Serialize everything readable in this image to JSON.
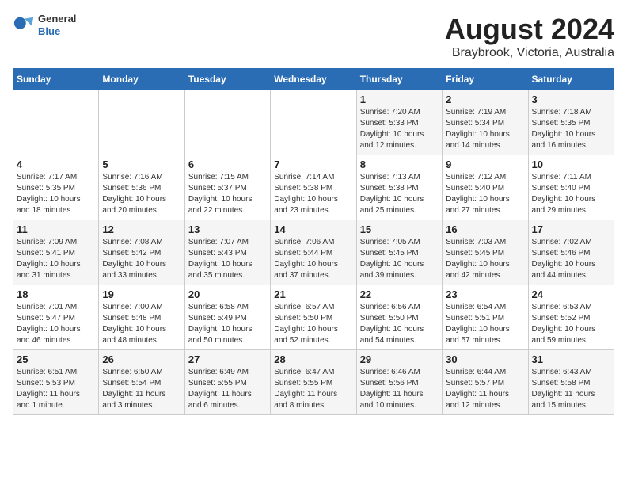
{
  "logo": {
    "general": "General",
    "blue": "Blue"
  },
  "title": "August 2024",
  "subtitle": "Braybrook, Victoria, Australia",
  "days_header": [
    "Sunday",
    "Monday",
    "Tuesday",
    "Wednesday",
    "Thursday",
    "Friday",
    "Saturday"
  ],
  "weeks": [
    [
      {
        "day": "",
        "info": ""
      },
      {
        "day": "",
        "info": ""
      },
      {
        "day": "",
        "info": ""
      },
      {
        "day": "",
        "info": ""
      },
      {
        "day": "1",
        "info": "Sunrise: 7:20 AM\nSunset: 5:33 PM\nDaylight: 10 hours\nand 12 minutes."
      },
      {
        "day": "2",
        "info": "Sunrise: 7:19 AM\nSunset: 5:34 PM\nDaylight: 10 hours\nand 14 minutes."
      },
      {
        "day": "3",
        "info": "Sunrise: 7:18 AM\nSunset: 5:35 PM\nDaylight: 10 hours\nand 16 minutes."
      }
    ],
    [
      {
        "day": "4",
        "info": "Sunrise: 7:17 AM\nSunset: 5:35 PM\nDaylight: 10 hours\nand 18 minutes."
      },
      {
        "day": "5",
        "info": "Sunrise: 7:16 AM\nSunset: 5:36 PM\nDaylight: 10 hours\nand 20 minutes."
      },
      {
        "day": "6",
        "info": "Sunrise: 7:15 AM\nSunset: 5:37 PM\nDaylight: 10 hours\nand 22 minutes."
      },
      {
        "day": "7",
        "info": "Sunrise: 7:14 AM\nSunset: 5:38 PM\nDaylight: 10 hours\nand 23 minutes."
      },
      {
        "day": "8",
        "info": "Sunrise: 7:13 AM\nSunset: 5:38 PM\nDaylight: 10 hours\nand 25 minutes."
      },
      {
        "day": "9",
        "info": "Sunrise: 7:12 AM\nSunset: 5:40 PM\nDaylight: 10 hours\nand 27 minutes."
      },
      {
        "day": "10",
        "info": "Sunrise: 7:11 AM\nSunset: 5:40 PM\nDaylight: 10 hours\nand 29 minutes."
      }
    ],
    [
      {
        "day": "11",
        "info": "Sunrise: 7:09 AM\nSunset: 5:41 PM\nDaylight: 10 hours\nand 31 minutes."
      },
      {
        "day": "12",
        "info": "Sunrise: 7:08 AM\nSunset: 5:42 PM\nDaylight: 10 hours\nand 33 minutes."
      },
      {
        "day": "13",
        "info": "Sunrise: 7:07 AM\nSunset: 5:43 PM\nDaylight: 10 hours\nand 35 minutes."
      },
      {
        "day": "14",
        "info": "Sunrise: 7:06 AM\nSunset: 5:44 PM\nDaylight: 10 hours\nand 37 minutes."
      },
      {
        "day": "15",
        "info": "Sunrise: 7:05 AM\nSunset: 5:45 PM\nDaylight: 10 hours\nand 39 minutes."
      },
      {
        "day": "16",
        "info": "Sunrise: 7:03 AM\nSunset: 5:45 PM\nDaylight: 10 hours\nand 42 minutes."
      },
      {
        "day": "17",
        "info": "Sunrise: 7:02 AM\nSunset: 5:46 PM\nDaylight: 10 hours\nand 44 minutes."
      }
    ],
    [
      {
        "day": "18",
        "info": "Sunrise: 7:01 AM\nSunset: 5:47 PM\nDaylight: 10 hours\nand 46 minutes."
      },
      {
        "day": "19",
        "info": "Sunrise: 7:00 AM\nSunset: 5:48 PM\nDaylight: 10 hours\nand 48 minutes."
      },
      {
        "day": "20",
        "info": "Sunrise: 6:58 AM\nSunset: 5:49 PM\nDaylight: 10 hours\nand 50 minutes."
      },
      {
        "day": "21",
        "info": "Sunrise: 6:57 AM\nSunset: 5:50 PM\nDaylight: 10 hours\nand 52 minutes."
      },
      {
        "day": "22",
        "info": "Sunrise: 6:56 AM\nSunset: 5:50 PM\nDaylight: 10 hours\nand 54 minutes."
      },
      {
        "day": "23",
        "info": "Sunrise: 6:54 AM\nSunset: 5:51 PM\nDaylight: 10 hours\nand 57 minutes."
      },
      {
        "day": "24",
        "info": "Sunrise: 6:53 AM\nSunset: 5:52 PM\nDaylight: 10 hours\nand 59 minutes."
      }
    ],
    [
      {
        "day": "25",
        "info": "Sunrise: 6:51 AM\nSunset: 5:53 PM\nDaylight: 11 hours\nand 1 minute."
      },
      {
        "day": "26",
        "info": "Sunrise: 6:50 AM\nSunset: 5:54 PM\nDaylight: 11 hours\nand 3 minutes."
      },
      {
        "day": "27",
        "info": "Sunrise: 6:49 AM\nSunset: 5:55 PM\nDaylight: 11 hours\nand 6 minutes."
      },
      {
        "day": "28",
        "info": "Sunrise: 6:47 AM\nSunset: 5:55 PM\nDaylight: 11 hours\nand 8 minutes."
      },
      {
        "day": "29",
        "info": "Sunrise: 6:46 AM\nSunset: 5:56 PM\nDaylight: 11 hours\nand 10 minutes."
      },
      {
        "day": "30",
        "info": "Sunrise: 6:44 AM\nSunset: 5:57 PM\nDaylight: 11 hours\nand 12 minutes."
      },
      {
        "day": "31",
        "info": "Sunrise: 6:43 AM\nSunset: 5:58 PM\nDaylight: 11 hours\nand 15 minutes."
      }
    ]
  ]
}
